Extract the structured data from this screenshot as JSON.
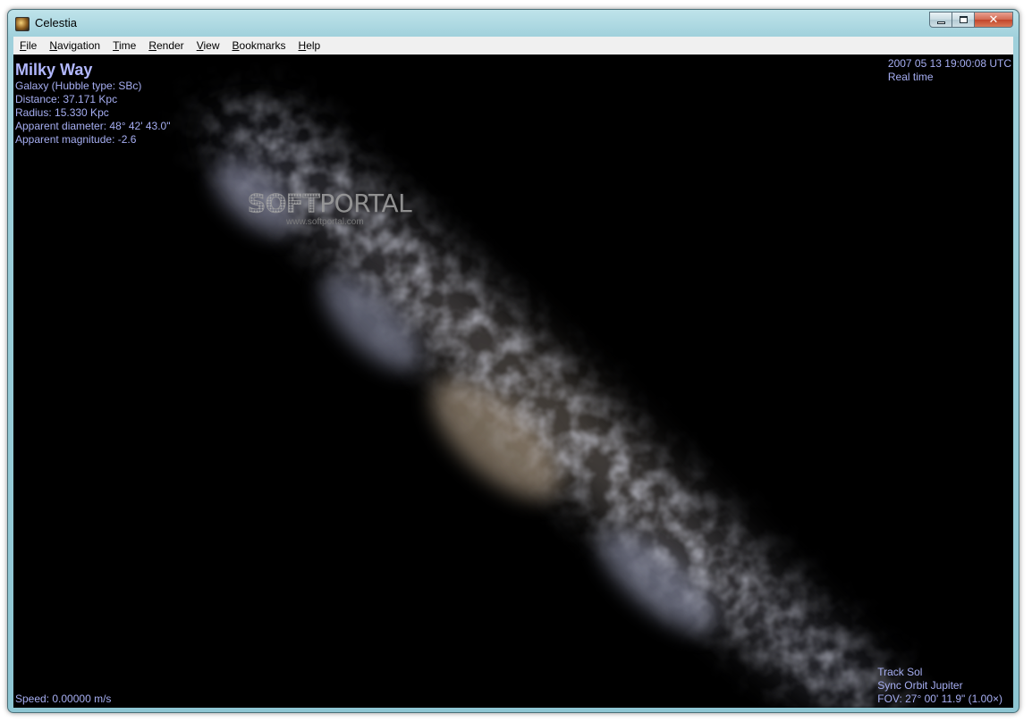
{
  "window": {
    "title": "Celestia",
    "icon": "celestia-app-icon"
  },
  "menu": [
    {
      "label": "File",
      "accel": "F",
      "rest": "ile"
    },
    {
      "label": "Navigation",
      "accel": "N",
      "rest": "avigation"
    },
    {
      "label": "Time",
      "accel": "T",
      "rest": "ime"
    },
    {
      "label": "Render",
      "accel": "R",
      "rest": "ender"
    },
    {
      "label": "View",
      "accel": "V",
      "rest": "iew"
    },
    {
      "label": "Bookmarks",
      "accel": "B",
      "rest": "ookmarks"
    },
    {
      "label": "Help",
      "accel": "H",
      "rest": "elp"
    }
  ],
  "object_info": {
    "name": "Milky Way",
    "type": "Galaxy (Hubble type: SBc)",
    "distance": "Distance: 37.171 Kpc",
    "radius": "Radius: 15.330 Kpc",
    "apparent_diameter": "Apparent diameter: 48° 42' 43.0\"",
    "apparent_magnitude": "Apparent magnitude: -2.6"
  },
  "time_info": {
    "datetime": "2007 05 13 19:00:08 UTC",
    "mode": "Real time"
  },
  "speed": "Speed: 0.00000 m/s",
  "tracking": {
    "track": "Track Sol",
    "sync": "Sync Orbit Jupiter",
    "fov": "FOV: 27° 00' 11.9\" (1.00×)"
  },
  "watermark": {
    "logo_part1": "SOFT",
    "logo_part2": "PORTAL",
    "url": "www.softportal.com"
  }
}
